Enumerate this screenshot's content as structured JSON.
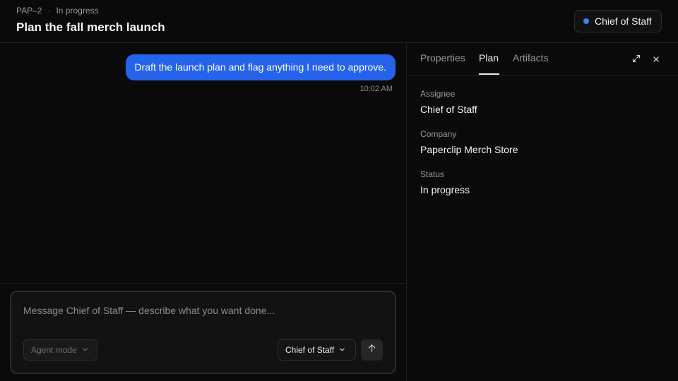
{
  "header": {
    "issue_id": "PAP–2",
    "separator": "·",
    "issue_status": "In progress",
    "title": "Plan the fall merch launch",
    "agent_name": "Chief of Staff",
    "agent_dot_color": "#3b82f6"
  },
  "chat": {
    "messages": [
      {
        "text": "Draft the launch plan and flag anything I need to approve.",
        "time": "10:02 AM"
      }
    ]
  },
  "composer": {
    "placeholder": "Message Chief of Staff — describe what you want done...",
    "value": "",
    "mode_label": "Agent mode",
    "agent_label": "Chief of Staff",
    "send_icon": "arrow-up-icon"
  },
  "panel": {
    "tabs": [
      {
        "label": "Properties",
        "active": false
      },
      {
        "label": "Plan",
        "active": true
      },
      {
        "label": "Artifacts",
        "active": false
      }
    ],
    "expand_icon": "expand-icon",
    "close_icon": "close-icon",
    "properties": [
      {
        "label": "Assignee",
        "value": "Chief of Staff"
      },
      {
        "label": "Company",
        "value": "Paperclip Merch Store"
      },
      {
        "label": "Status",
        "value": "In progress"
      }
    ]
  },
  "colors": {
    "accent": "#2563eb",
    "background": "#0a0a0a"
  }
}
